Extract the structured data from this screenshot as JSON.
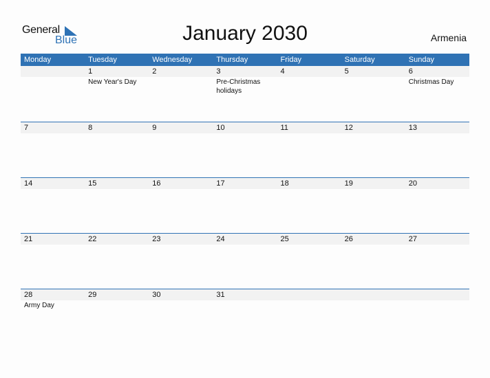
{
  "logo": {
    "line1": "General",
    "line2": "Blue"
  },
  "title": "January 2030",
  "country": "Armenia",
  "colors": {
    "accent": "#2f72b4",
    "row_band": "#f2f2f2"
  },
  "weekdays": [
    "Monday",
    "Tuesday",
    "Wednesday",
    "Thursday",
    "Friday",
    "Saturday",
    "Sunday"
  ],
  "weeks": [
    {
      "days": [
        "",
        "1",
        "2",
        "3",
        "4",
        "5",
        "6"
      ],
      "holidays": [
        "",
        "New Year's Day",
        "",
        "Pre-Christmas holidays",
        "",
        "",
        "Christmas Day"
      ]
    },
    {
      "days": [
        "7",
        "8",
        "9",
        "10",
        "11",
        "12",
        "13"
      ],
      "holidays": [
        "",
        "",
        "",
        "",
        "",
        "",
        ""
      ]
    },
    {
      "days": [
        "14",
        "15",
        "16",
        "17",
        "18",
        "19",
        "20"
      ],
      "holidays": [
        "",
        "",
        "",
        "",
        "",
        "",
        ""
      ]
    },
    {
      "days": [
        "21",
        "22",
        "23",
        "24",
        "25",
        "26",
        "27"
      ],
      "holidays": [
        "",
        "",
        "",
        "",
        "",
        "",
        ""
      ]
    },
    {
      "days": [
        "28",
        "29",
        "30",
        "31",
        "",
        "",
        ""
      ],
      "holidays": [
        "Army Day",
        "",
        "",
        "",
        "",
        "",
        ""
      ]
    }
  ]
}
